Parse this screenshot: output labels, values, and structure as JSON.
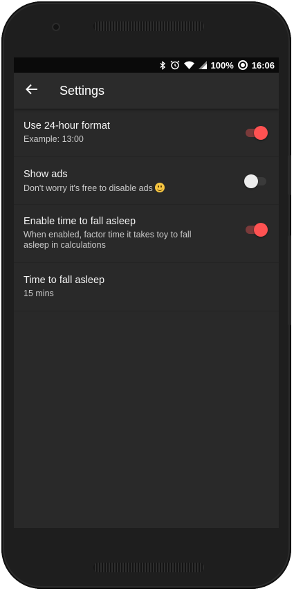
{
  "status_bar": {
    "battery": "100%",
    "time": "16:06",
    "icons": [
      "bluetooth-icon",
      "alarm-icon",
      "wifi-icon",
      "cell-signal-icon",
      "battery-icon"
    ]
  },
  "toolbar": {
    "title": "Settings",
    "back_icon": "arrow-left-icon"
  },
  "settings": [
    {
      "label": "Use 24-hour format",
      "sub": "Example: 13:00",
      "toggle": true
    },
    {
      "label": "Show ads",
      "sub": "Don't worry it's free to disable ads",
      "sub_emoji": "smiling-face-icon",
      "toggle": false
    },
    {
      "label": "Enable time to fall asleep",
      "sub": "When enabled, factor time it takes toy to fall asleep in calculations",
      "toggle": true
    },
    {
      "label": "Time to fall asleep",
      "sub": "15 mins"
    }
  ],
  "colors": {
    "accent": "#ff5252",
    "background": "#292929",
    "toolbar": "#2b2b2b"
  }
}
